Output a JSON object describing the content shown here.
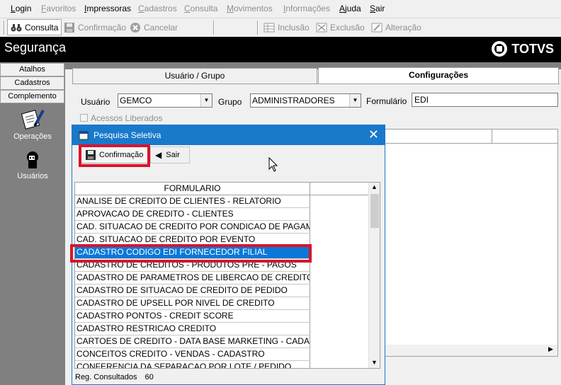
{
  "menubar": {
    "items": [
      {
        "label": "Login",
        "enabled": true
      },
      {
        "label": "Favoritos",
        "enabled": false
      },
      {
        "label": "Impressoras",
        "enabled": true
      },
      {
        "label": "Cadastros",
        "enabled": false
      },
      {
        "label": "Consulta",
        "enabled": false
      },
      {
        "label": "Movimentos",
        "enabled": false
      },
      {
        "label": "Informações",
        "enabled": false
      },
      {
        "label": "Ajuda",
        "enabled": true
      },
      {
        "label": "Sair",
        "enabled": true
      }
    ]
  },
  "toolbar": {
    "consulta": "Consulta",
    "confirmacao": "Confirmação",
    "cancelar": "Cancelar",
    "inclusao": "Inclusão",
    "exclusao": "Exclusão",
    "alteracao": "Alteração"
  },
  "header": {
    "title": "Segurança",
    "logo": "TOTVS"
  },
  "sidebar": {
    "tabs": [
      "Atalhos",
      "Cadastros",
      "Complemento"
    ],
    "shortcuts": [
      {
        "label": "Operações",
        "icon": "notepad-pen-icon"
      },
      {
        "label": "Usuários",
        "icon": "user-silhouette-icon"
      }
    ]
  },
  "main": {
    "tabs": [
      "Usuário  / Grupo",
      "Configurações"
    ],
    "active_tab": "Configurações",
    "usuario_label": "Usuário",
    "usuario_value": "GEMCO",
    "grupo_label": "Grupo",
    "grupo_value": "ADMINISTRADORES",
    "formulario_label": "Formulário",
    "formulario_value": "EDI",
    "acessos_label": "Acessos Liberados",
    "acessos_checked": false
  },
  "dialog": {
    "title": "Pesquisa Seletiva",
    "confirm_label": "Confirmação",
    "exit_label": "Sair",
    "column_header": "FORMULARIO",
    "rows": [
      "ANALISE DE CREDITO DE CLIENTES - RELATORIO",
      "APROVACAO DE CREDITO - CLIENTES",
      "CAD. SITUACAO DE CREDITO POR CONDICAO DE PAGAMENTO",
      "CAD. SITUACAO DE CREDITO POR EVENTO",
      "CADASTRO CODIGO EDI FORNECEDOR FILIAL",
      "CADASTRO DE CREDITOS - PRODUTOS PRE - PAGOS",
      "CADASTRO DE PARAMETROS DE LIBERCAO DE CREDITO",
      "CADASTRO DE SITUACAO DE CREDITO DE PEDIDO",
      "CADASTRO DE UPSELL POR NIVEL DE CREDITO",
      "CADASTRO PONTOS - CREDIT SCORE",
      "CADASTRO RESTRICAO CREDITO",
      "CARTOES DE CREDITO - DATA BASE MARKETING - CADASTRO",
      "CONCEITOS CREDITO - VENDAS - CADASTRO",
      "CONFERENCIA DA SEPARACAO POR LOTE / PEDIDO"
    ],
    "selected_row": "CADASTRO CODIGO EDI FORNECEDOR FILIAL",
    "status_label": "Reg. Consultados",
    "status_count": "60"
  },
  "colors": {
    "highlight": "#d9142b",
    "selection": "#0a78d7",
    "titlebar": "#1979ca"
  }
}
